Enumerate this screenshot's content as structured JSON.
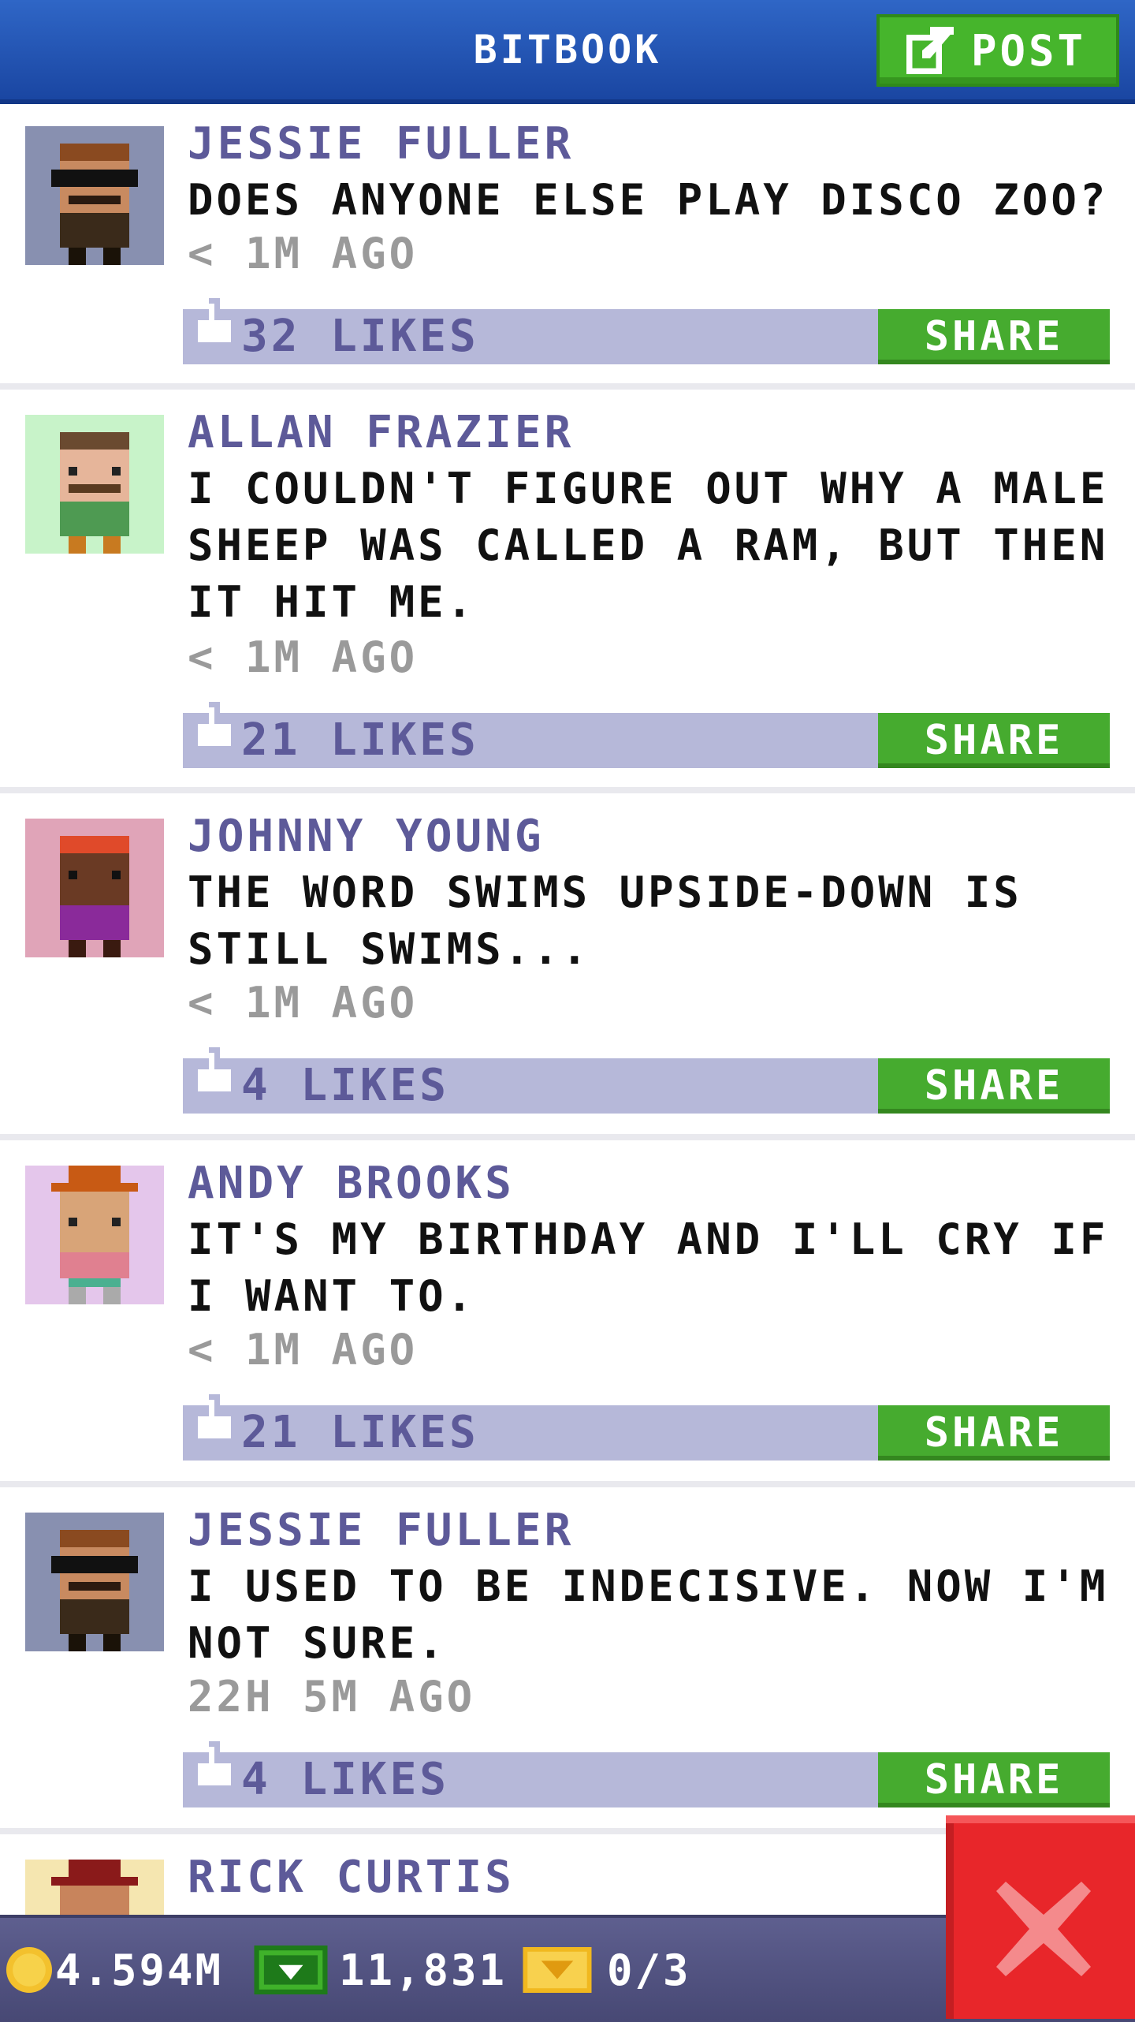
{
  "header": {
    "title": "BITBOOK",
    "post_label": "POST"
  },
  "posts": [
    {
      "name": "JESSIE FULLER",
      "message": "DOES ANYONE ELSE PLAY DISCO ZOO?",
      "time": "< 1M AGO",
      "likes": "32 LIKES",
      "share": "SHARE",
      "avatar_bg": "#8890b0"
    },
    {
      "name": "ALLAN FRAZIER",
      "message": "I COULDN'T FIGURE OUT WHY A MALE SHEEP WAS CALLED A RAM, BUT THEN IT HIT ME.",
      "time": "< 1M AGO",
      "likes": "21 LIKES",
      "share": "SHARE",
      "avatar_bg": "#c8f3c9"
    },
    {
      "name": "JOHNNY YOUNG",
      "message": "THE WORD SWIMS UPSIDE-DOWN IS STILL SWIMS...",
      "time": "< 1M AGO",
      "likes": "4 LIKES",
      "share": "SHARE",
      "avatar_bg": "#e0a4b8"
    },
    {
      "name": "ANDY BROOKS",
      "message": "IT'S MY BIRTHDAY AND I'LL CRY IF I WANT TO.",
      "time": "< 1M AGO",
      "likes": "21 LIKES",
      "share": "SHARE",
      "avatar_bg": "#e4c6eb"
    },
    {
      "name": "JESSIE FULLER",
      "message": "I USED TO BE INDECISIVE. NOW I'M NOT SURE.",
      "time": "22H 5M AGO",
      "likes": "4 LIKES",
      "share": "SHARE",
      "avatar_bg": "#8890b0"
    },
    {
      "name": "RICK CURTIS",
      "avatar_bg": "#f5e6b0"
    }
  ],
  "status_bar": {
    "coins": "4.594M",
    "bux": "11,831",
    "tickets": "0/3"
  },
  "icons": {
    "post": "edit-icon",
    "like": "thumbs-up-icon",
    "coin": "coin-icon",
    "bux": "bux-icon",
    "ticket": "ticket-icon",
    "close": "close-icon"
  }
}
